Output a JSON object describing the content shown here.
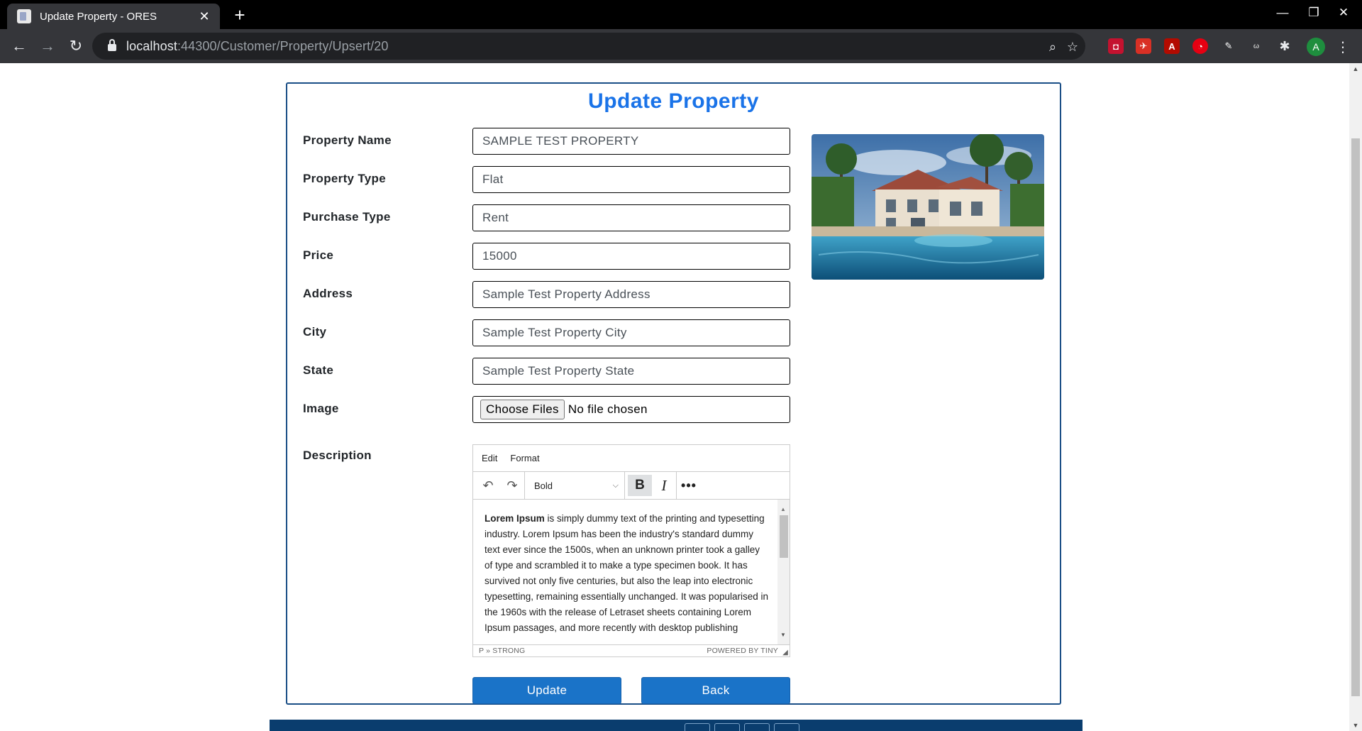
{
  "browser": {
    "tab_title": "Update Property - ORES",
    "url_host": "localhost",
    "url_rest": ":44300/Customer/Property/Upsert/20",
    "profile_initial": "A"
  },
  "page": {
    "title": "Update Property"
  },
  "form": {
    "property_name": {
      "label": "Property Name",
      "value": "SAMPLE TEST PROPERTY"
    },
    "property_type": {
      "label": "Property Type",
      "value": "Flat"
    },
    "purchase_type": {
      "label": "Purchase Type",
      "value": "Rent"
    },
    "price": {
      "label": "Price",
      "value": "15000"
    },
    "address": {
      "label": "Address",
      "value": "Sample Test Property Address"
    },
    "city": {
      "label": "City",
      "value": "Sample Test Property City"
    },
    "state": {
      "label": "State",
      "value": "Sample Test Property State"
    },
    "image": {
      "label": "Image",
      "button": "Choose Files",
      "status": "No file chosen"
    },
    "description": {
      "label": "Description"
    }
  },
  "editor": {
    "menu_edit": "Edit",
    "menu_format": "Format",
    "format_select": "Bold",
    "bold_text": "Lorem Ipsum",
    "body_text": " is simply dummy text of the printing and typesetting industry. Lorem Ipsum has been the industry's standard dummy text ever since the 1500s, when an unknown printer took a galley of type and scrambled it to make a type specimen book. It has survived not only five centuries, but also the leap into electronic typesetting, remaining essentially unchanged. It was popularised in the 1960s with the release of Letraset sheets containing Lorem Ipsum passages, and more recently with desktop publishing",
    "status_path": "P » STRONG",
    "status_brand": "POWERED BY TINY"
  },
  "buttons": {
    "update": "Update",
    "back": "Back"
  },
  "colors": {
    "accent": "#1a73e8",
    "button": "#1a73c8",
    "card_border": "#1a4e86",
    "footer": "#0a3d6e"
  }
}
